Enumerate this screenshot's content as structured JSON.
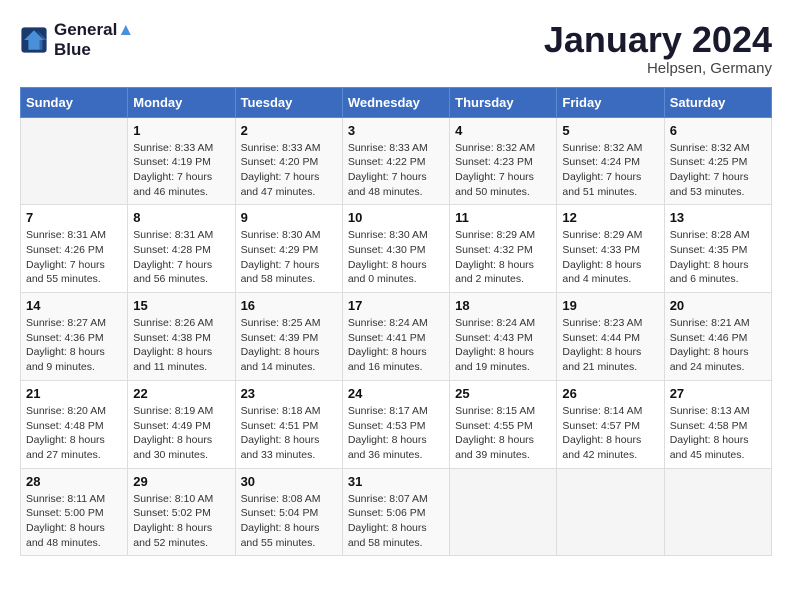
{
  "header": {
    "logo_line1": "General",
    "logo_line2": "Blue",
    "month_title": "January 2024",
    "location": "Helpsen, Germany"
  },
  "weekdays": [
    "Sunday",
    "Monday",
    "Tuesday",
    "Wednesday",
    "Thursday",
    "Friday",
    "Saturday"
  ],
  "weeks": [
    [
      {
        "day": "",
        "sunrise": "",
        "sunset": "",
        "daylight": ""
      },
      {
        "day": "1",
        "sunrise": "Sunrise: 8:33 AM",
        "sunset": "Sunset: 4:19 PM",
        "daylight": "Daylight: 7 hours and 46 minutes."
      },
      {
        "day": "2",
        "sunrise": "Sunrise: 8:33 AM",
        "sunset": "Sunset: 4:20 PM",
        "daylight": "Daylight: 7 hours and 47 minutes."
      },
      {
        "day": "3",
        "sunrise": "Sunrise: 8:33 AM",
        "sunset": "Sunset: 4:22 PM",
        "daylight": "Daylight: 7 hours and 48 minutes."
      },
      {
        "day": "4",
        "sunrise": "Sunrise: 8:32 AM",
        "sunset": "Sunset: 4:23 PM",
        "daylight": "Daylight: 7 hours and 50 minutes."
      },
      {
        "day": "5",
        "sunrise": "Sunrise: 8:32 AM",
        "sunset": "Sunset: 4:24 PM",
        "daylight": "Daylight: 7 hours and 51 minutes."
      },
      {
        "day": "6",
        "sunrise": "Sunrise: 8:32 AM",
        "sunset": "Sunset: 4:25 PM",
        "daylight": "Daylight: 7 hours and 53 minutes."
      }
    ],
    [
      {
        "day": "7",
        "sunrise": "Sunrise: 8:31 AM",
        "sunset": "Sunset: 4:26 PM",
        "daylight": "Daylight: 7 hours and 55 minutes."
      },
      {
        "day": "8",
        "sunrise": "Sunrise: 8:31 AM",
        "sunset": "Sunset: 4:28 PM",
        "daylight": "Daylight: 7 hours and 56 minutes."
      },
      {
        "day": "9",
        "sunrise": "Sunrise: 8:30 AM",
        "sunset": "Sunset: 4:29 PM",
        "daylight": "Daylight: 7 hours and 58 minutes."
      },
      {
        "day": "10",
        "sunrise": "Sunrise: 8:30 AM",
        "sunset": "Sunset: 4:30 PM",
        "daylight": "Daylight: 8 hours and 0 minutes."
      },
      {
        "day": "11",
        "sunrise": "Sunrise: 8:29 AM",
        "sunset": "Sunset: 4:32 PM",
        "daylight": "Daylight: 8 hours and 2 minutes."
      },
      {
        "day": "12",
        "sunrise": "Sunrise: 8:29 AM",
        "sunset": "Sunset: 4:33 PM",
        "daylight": "Daylight: 8 hours and 4 minutes."
      },
      {
        "day": "13",
        "sunrise": "Sunrise: 8:28 AM",
        "sunset": "Sunset: 4:35 PM",
        "daylight": "Daylight: 8 hours and 6 minutes."
      }
    ],
    [
      {
        "day": "14",
        "sunrise": "Sunrise: 8:27 AM",
        "sunset": "Sunset: 4:36 PM",
        "daylight": "Daylight: 8 hours and 9 minutes."
      },
      {
        "day": "15",
        "sunrise": "Sunrise: 8:26 AM",
        "sunset": "Sunset: 4:38 PM",
        "daylight": "Daylight: 8 hours and 11 minutes."
      },
      {
        "day": "16",
        "sunrise": "Sunrise: 8:25 AM",
        "sunset": "Sunset: 4:39 PM",
        "daylight": "Daylight: 8 hours and 14 minutes."
      },
      {
        "day": "17",
        "sunrise": "Sunrise: 8:24 AM",
        "sunset": "Sunset: 4:41 PM",
        "daylight": "Daylight: 8 hours and 16 minutes."
      },
      {
        "day": "18",
        "sunrise": "Sunrise: 8:24 AM",
        "sunset": "Sunset: 4:43 PM",
        "daylight": "Daylight: 8 hours and 19 minutes."
      },
      {
        "day": "19",
        "sunrise": "Sunrise: 8:23 AM",
        "sunset": "Sunset: 4:44 PM",
        "daylight": "Daylight: 8 hours and 21 minutes."
      },
      {
        "day": "20",
        "sunrise": "Sunrise: 8:21 AM",
        "sunset": "Sunset: 4:46 PM",
        "daylight": "Daylight: 8 hours and 24 minutes."
      }
    ],
    [
      {
        "day": "21",
        "sunrise": "Sunrise: 8:20 AM",
        "sunset": "Sunset: 4:48 PM",
        "daylight": "Daylight: 8 hours and 27 minutes."
      },
      {
        "day": "22",
        "sunrise": "Sunrise: 8:19 AM",
        "sunset": "Sunset: 4:49 PM",
        "daylight": "Daylight: 8 hours and 30 minutes."
      },
      {
        "day": "23",
        "sunrise": "Sunrise: 8:18 AM",
        "sunset": "Sunset: 4:51 PM",
        "daylight": "Daylight: 8 hours and 33 minutes."
      },
      {
        "day": "24",
        "sunrise": "Sunrise: 8:17 AM",
        "sunset": "Sunset: 4:53 PM",
        "daylight": "Daylight: 8 hours and 36 minutes."
      },
      {
        "day": "25",
        "sunrise": "Sunrise: 8:15 AM",
        "sunset": "Sunset: 4:55 PM",
        "daylight": "Daylight: 8 hours and 39 minutes."
      },
      {
        "day": "26",
        "sunrise": "Sunrise: 8:14 AM",
        "sunset": "Sunset: 4:57 PM",
        "daylight": "Daylight: 8 hours and 42 minutes."
      },
      {
        "day": "27",
        "sunrise": "Sunrise: 8:13 AM",
        "sunset": "Sunset: 4:58 PM",
        "daylight": "Daylight: 8 hours and 45 minutes."
      }
    ],
    [
      {
        "day": "28",
        "sunrise": "Sunrise: 8:11 AM",
        "sunset": "Sunset: 5:00 PM",
        "daylight": "Daylight: 8 hours and 48 minutes."
      },
      {
        "day": "29",
        "sunrise": "Sunrise: 8:10 AM",
        "sunset": "Sunset: 5:02 PM",
        "daylight": "Daylight: 8 hours and 52 minutes."
      },
      {
        "day": "30",
        "sunrise": "Sunrise: 8:08 AM",
        "sunset": "Sunset: 5:04 PM",
        "daylight": "Daylight: 8 hours and 55 minutes."
      },
      {
        "day": "31",
        "sunrise": "Sunrise: 8:07 AM",
        "sunset": "Sunset: 5:06 PM",
        "daylight": "Daylight: 8 hours and 58 minutes."
      },
      {
        "day": "",
        "sunrise": "",
        "sunset": "",
        "daylight": ""
      },
      {
        "day": "",
        "sunrise": "",
        "sunset": "",
        "daylight": ""
      },
      {
        "day": "",
        "sunrise": "",
        "sunset": "",
        "daylight": ""
      }
    ]
  ]
}
